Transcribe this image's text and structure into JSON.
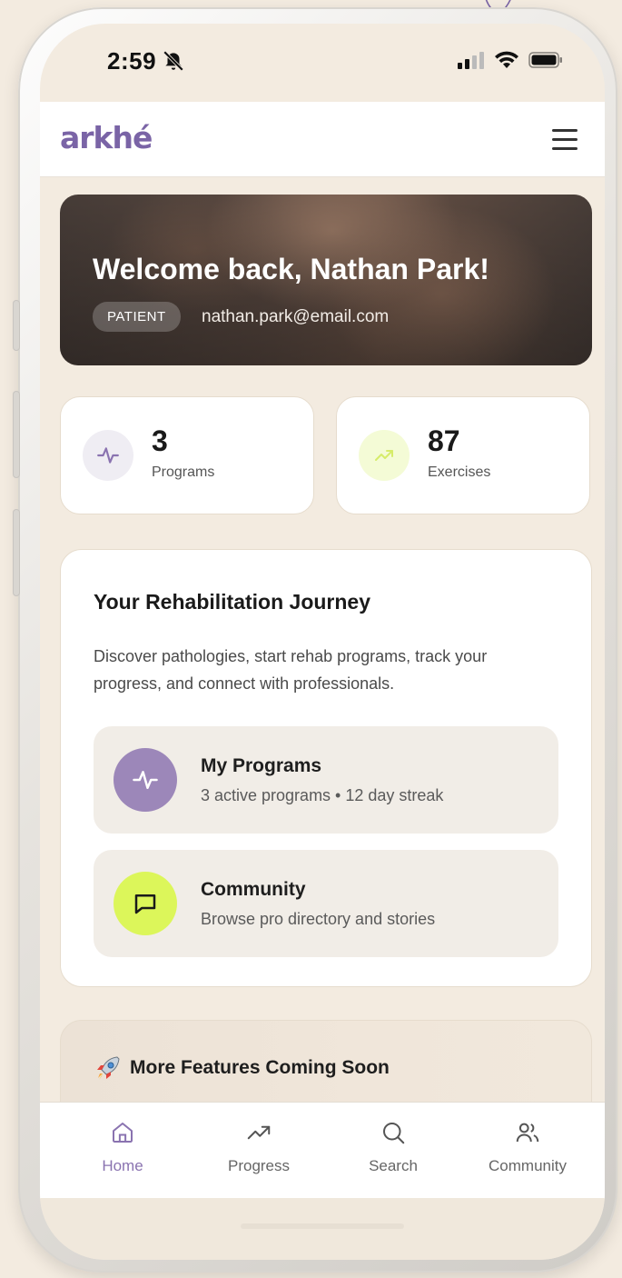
{
  "status": {
    "time": "2:59"
  },
  "app": {
    "logo": "arkhé"
  },
  "hero": {
    "title": "Welcome back, Nathan Park!",
    "badge": "PATIENT",
    "email": "nathan.park@email.com"
  },
  "stats": [
    {
      "value": "3",
      "label": "Programs",
      "icon": "activity-icon"
    },
    {
      "value": "87",
      "label": "Exercises",
      "icon": "trending-up-icon"
    }
  ],
  "journey": {
    "title": "Your Rehabilitation Journey",
    "description": "Discover pathologies, start rehab programs, track your progress, and connect with professionals.",
    "items": [
      {
        "title": "My Programs",
        "subtitle": "3 active programs • 12 day streak",
        "icon": "activity-icon"
      },
      {
        "title": "Community",
        "subtitle": "Browse pro directory and stories",
        "icon": "message-square-icon"
      }
    ]
  },
  "coming_soon": {
    "title": "More Features Coming Soon",
    "icon": "rocket-icon"
  },
  "tabs": [
    {
      "label": "Home",
      "icon": "home-icon",
      "active": true
    },
    {
      "label": "Progress",
      "icon": "trending-up-icon"
    },
    {
      "label": "Search",
      "icon": "search-icon"
    },
    {
      "label": "Community",
      "icon": "users-icon"
    }
  ],
  "colors": {
    "accent": "#8a73b0",
    "brand": "#7a64a6",
    "lime": "#dcf65a",
    "background": "#f3ebe0"
  }
}
